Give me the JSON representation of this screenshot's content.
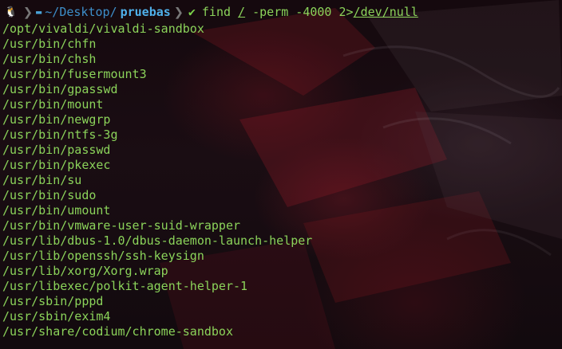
{
  "prompt": {
    "os_icon": "linux-tux-icon",
    "folder_icon": "folder-icon",
    "dir_prefix": "~/Desktop/",
    "dir_current": "pruebas",
    "status_icon": "checkmark-icon",
    "command": {
      "name": "find",
      "arg_path": "/",
      "rest": " -perm -4000 2>",
      "redirect": "/dev/null"
    }
  },
  "output_lines": [
    "/opt/vivaldi/vivaldi-sandbox",
    "/usr/bin/chfn",
    "/usr/bin/chsh",
    "/usr/bin/fusermount3",
    "/usr/bin/gpasswd",
    "/usr/bin/mount",
    "/usr/bin/newgrp",
    "/usr/bin/ntfs-3g",
    "/usr/bin/passwd",
    "/usr/bin/pkexec",
    "/usr/bin/su",
    "/usr/bin/sudo",
    "/usr/bin/umount",
    "/usr/bin/vmware-user-suid-wrapper",
    "/usr/lib/dbus-1.0/dbus-daemon-launch-helper",
    "/usr/lib/openssh/ssh-keysign",
    "/usr/lib/xorg/Xorg.wrap",
    "/usr/libexec/polkit-agent-helper-1",
    "/usr/sbin/pppd",
    "/usr/sbin/exim4",
    "/usr/share/codium/chrome-sandbox"
  ],
  "colors": {
    "output_text": "#8bd35a",
    "dir_text": "#3d8ec9",
    "status_ok": "#7cd34a",
    "background": "#120b10"
  }
}
